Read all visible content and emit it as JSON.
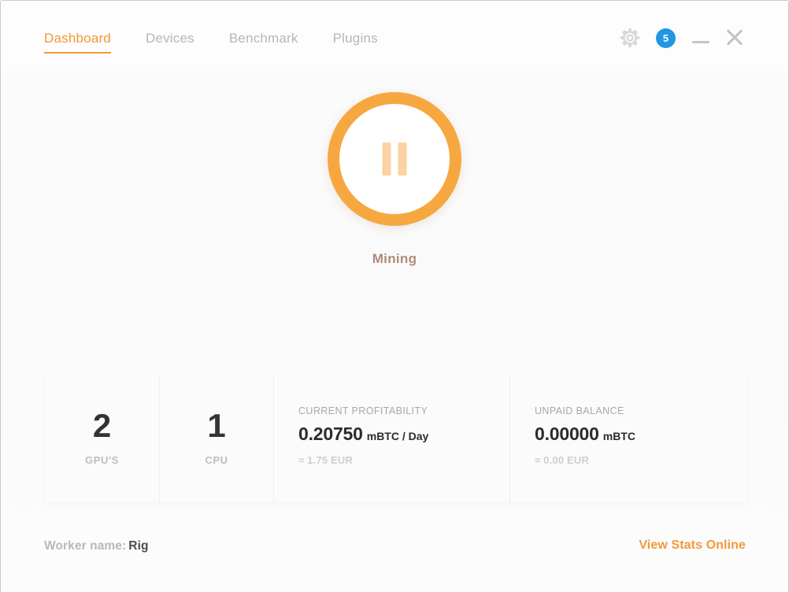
{
  "window": {
    "controls": {
      "settings_icon": "gear-icon",
      "notification_badge": "5",
      "minimize_label": "—",
      "close_label": "✕"
    }
  },
  "tabs": [
    {
      "label": "Dashboard",
      "active": true
    },
    {
      "label": "Devices",
      "active": false
    },
    {
      "label": "Benchmark",
      "active": false
    },
    {
      "label": "Plugins",
      "active": false
    }
  ],
  "mining": {
    "state_label": "Mining",
    "button_icon": "pause-icon",
    "ring_color": "#f7a73f",
    "icon_color": "#fcd2a4",
    "label_color": "#ad8b77"
  },
  "stats": {
    "devices": [
      {
        "value": "2",
        "label": "GPU'S"
      },
      {
        "value": "1",
        "label": "CPU"
      }
    ],
    "metrics": [
      {
        "title": "CURRENT PROFITABILITY",
        "value": "0.20750",
        "unit": "mBTC / Day",
        "sub": "≈ 1.75 EUR"
      },
      {
        "title": "UNPAID BALANCE",
        "value": "0.00000",
        "unit": "mBTC",
        "sub": "≈ 0.00 EUR"
      }
    ]
  },
  "footer": {
    "worker_label": "Worker name:",
    "worker_name": "Rig",
    "stats_link": "View Stats Online",
    "link_color": "#f2983a"
  }
}
